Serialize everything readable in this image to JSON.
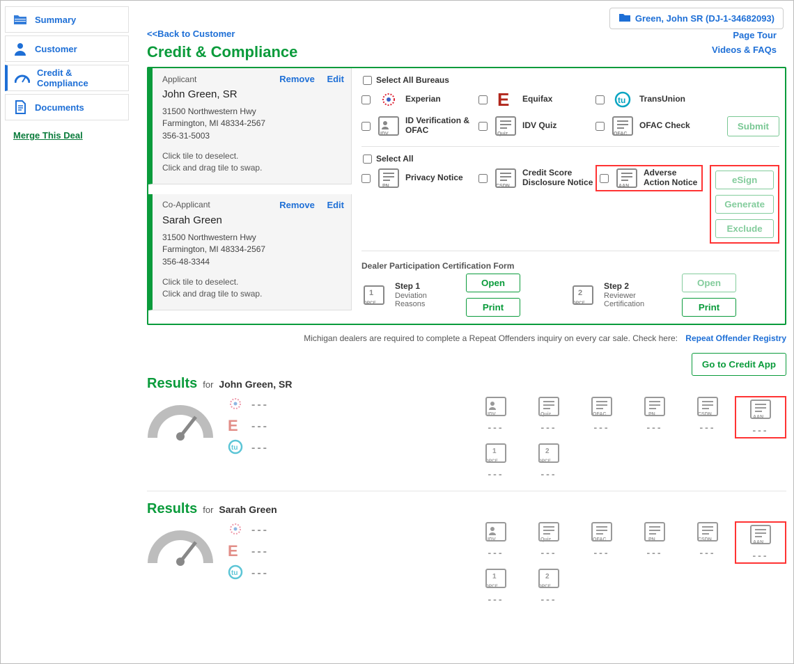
{
  "customer_badge": "Green, John SR (DJ-1-34682093)",
  "sidebar": {
    "items": [
      {
        "id": "summary",
        "label": "Summary"
      },
      {
        "id": "customer",
        "label": "Customer"
      },
      {
        "id": "credit",
        "label": "Credit & Compliance"
      },
      {
        "id": "documents",
        "label": "Documents"
      }
    ],
    "merge_label": "Merge This Deal"
  },
  "header": {
    "back_label": "<<Back to Customer",
    "page_title": "Credit & Compliance",
    "links": {
      "page_tour": "Page Tour",
      "videos": "Videos & FAQs"
    }
  },
  "applicants": [
    {
      "role": "Applicant",
      "name": "John Green, SR",
      "addr1": "31500 Northwestern Hwy",
      "addr2": "Farmington, MI 48334-2567",
      "ssn_last": "356-31-5003",
      "hint1": "Click tile to deselect.",
      "hint2": "Click and drag tile to swap.",
      "links": {
        "remove": "Remove",
        "edit": "Edit"
      }
    },
    {
      "role": "Co-Applicant",
      "name": "Sarah Green",
      "addr1": "31500 Northwestern Hwy",
      "addr2": "Farmington, MI 48334-2567",
      "ssn_last": "356-48-3344",
      "hint1": "Click tile to deselect.",
      "hint2": "Click and drag tile to swap.",
      "links": {
        "remove": "Remove",
        "edit": "Edit"
      }
    }
  ],
  "bureaus": {
    "select_all": "Select All Bureaus",
    "items": [
      {
        "key": "experian",
        "label": "Experian"
      },
      {
        "key": "equifax",
        "label": "Equifax"
      },
      {
        "key": "transunion",
        "label": "TransUnion"
      }
    ],
    "checks": [
      {
        "key": "idv",
        "label": "ID Verification & OFAC",
        "icon": "IDV"
      },
      {
        "key": "idvquiz",
        "label": "IDV Quiz",
        "icon": "Quiz"
      },
      {
        "key": "ofac",
        "label": "OFAC Check",
        "icon": "OFAC"
      }
    ],
    "submit": "Submit"
  },
  "notices": {
    "select_all": "Select All",
    "items": [
      {
        "key": "pn",
        "label": "Privacy Notice",
        "icon": "PN"
      },
      {
        "key": "csdn",
        "label": "Credit Score Disclosure Notice",
        "icon": "CSDN"
      },
      {
        "key": "aan",
        "label": "Adverse Action Notice",
        "icon": "AAN"
      }
    ],
    "actions": {
      "esign": "eSign",
      "generate": "Generate",
      "exclude": "Exclude"
    }
  },
  "dpcf": {
    "title": "Dealer Participation Certification Form",
    "step1": {
      "title": "Step 1",
      "sub": "Deviation Reasons",
      "open": "Open",
      "print": "Print"
    },
    "step2": {
      "title": "Step 2",
      "sub": "Reviewer Certification",
      "open": "Open",
      "print": "Print"
    }
  },
  "footer_note": {
    "text": "Michigan dealers are required to complete a Repeat Offenders inquiry on every car sale. Check here:",
    "link_label": "Repeat Offender Registry"
  },
  "credit_app_btn": "Go to Credit App",
  "results": {
    "title": "Results",
    "for_label": "for",
    "sections": [
      {
        "name": "John Green, SR"
      },
      {
        "name": "Sarah Green"
      }
    ],
    "docs": [
      "IDV",
      "Quiz",
      "OFAC",
      "PN",
      "CSDN",
      "AAN",
      "DPCF 1",
      "DPCF 2"
    ],
    "dash": "---"
  }
}
